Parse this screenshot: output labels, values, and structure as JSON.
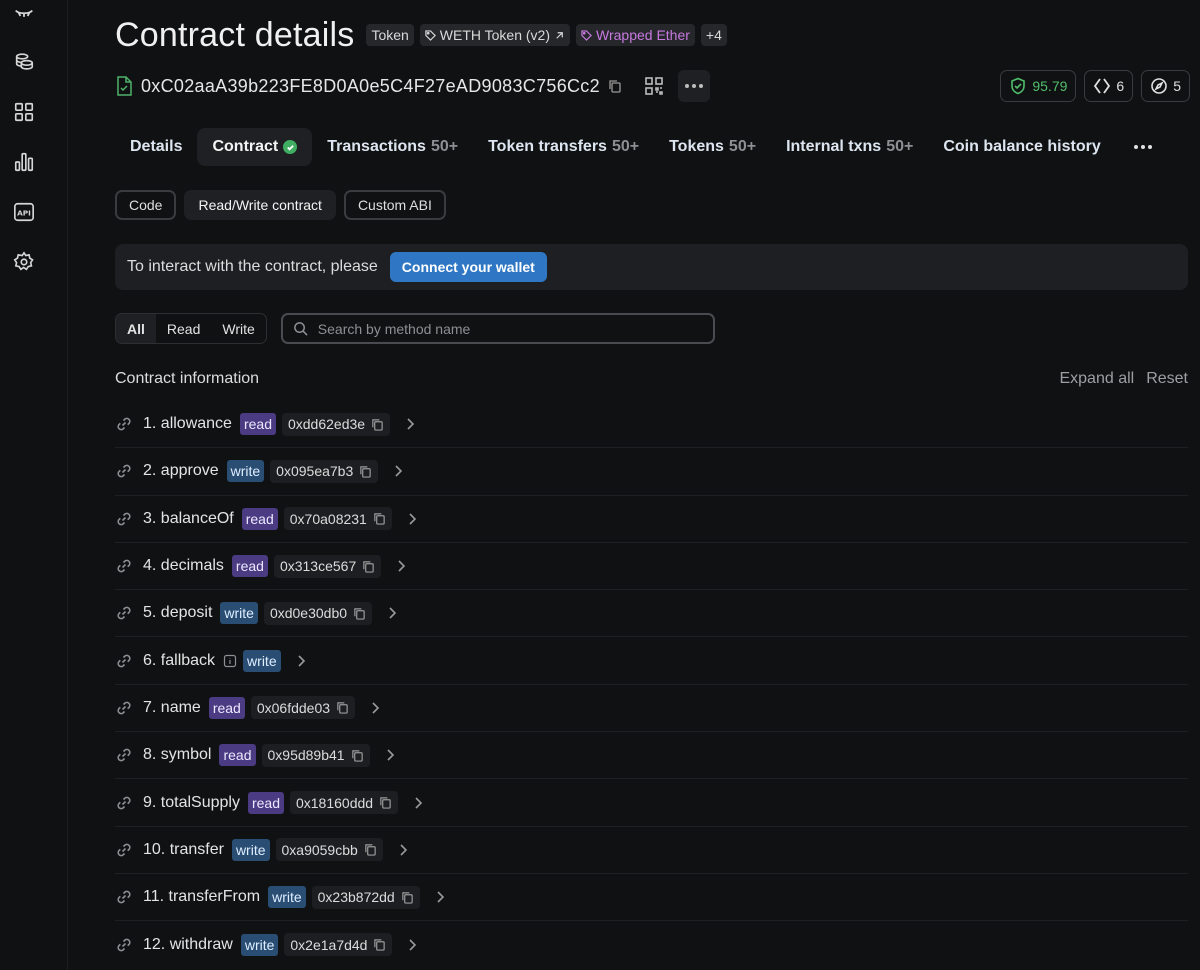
{
  "sidebar": {
    "icons": [
      "logo-icon",
      "coins-icon",
      "grid-icon",
      "bar-chart-icon",
      "api-icon",
      "settings-icon"
    ]
  },
  "header": {
    "title": "Contract details",
    "tags": [
      {
        "label": "Token",
        "style": "plain"
      },
      {
        "label": "WETH Token (v2)",
        "style": "link"
      },
      {
        "label": "Wrapped Ether",
        "style": "purple"
      },
      {
        "label": "+4",
        "style": "plain"
      }
    ]
  },
  "address": {
    "value": "0xC02aaA39b223FE8D0A0e5C4F27eAD9083C756Cc2"
  },
  "badges": {
    "score": "95.79",
    "code_count": "6",
    "explore_count": "5"
  },
  "tabs": [
    {
      "label": "Details",
      "count": ""
    },
    {
      "label": "Contract",
      "count": ""
    },
    {
      "label": "Transactions",
      "count": "50+"
    },
    {
      "label": "Token transfers",
      "count": "50+"
    },
    {
      "label": "Tokens",
      "count": "50+"
    },
    {
      "label": "Internal txns",
      "count": "50+"
    },
    {
      "label": "Coin balance history",
      "count": ""
    }
  ],
  "subtabs": [
    "Code",
    "Read/Write contract",
    "Custom ABI"
  ],
  "notice": {
    "text": "To interact with the contract, please",
    "button": "Connect your wallet"
  },
  "filter": {
    "segments": [
      "All",
      "Read",
      "Write"
    ],
    "search_placeholder": "Search by method name"
  },
  "section": {
    "title": "Contract information",
    "expand_all": "Expand all",
    "reset": "Reset"
  },
  "methods": [
    {
      "name": "1. allowance",
      "type": "read",
      "selector": "0xdd62ed3e"
    },
    {
      "name": "2. approve",
      "type": "write",
      "selector": "0x095ea7b3"
    },
    {
      "name": "3. balanceOf",
      "type": "read",
      "selector": "0x70a08231"
    },
    {
      "name": "4. decimals",
      "type": "read",
      "selector": "0x313ce567"
    },
    {
      "name": "5. deposit",
      "type": "write",
      "selector": "0xd0e30db0"
    },
    {
      "name": "6. fallback",
      "type": "write",
      "selector": ""
    },
    {
      "name": "7. name",
      "type": "read",
      "selector": "0x06fdde03"
    },
    {
      "name": "8. symbol",
      "type": "read",
      "selector": "0x95d89b41"
    },
    {
      "name": "9. totalSupply",
      "type": "read",
      "selector": "0x18160ddd"
    },
    {
      "name": "10. transfer",
      "type": "write",
      "selector": "0xa9059cbb"
    },
    {
      "name": "11. transferFrom",
      "type": "write",
      "selector": "0x23b872dd"
    },
    {
      "name": "12. withdraw",
      "type": "write",
      "selector": "0x2e1a7d4d"
    }
  ]
}
